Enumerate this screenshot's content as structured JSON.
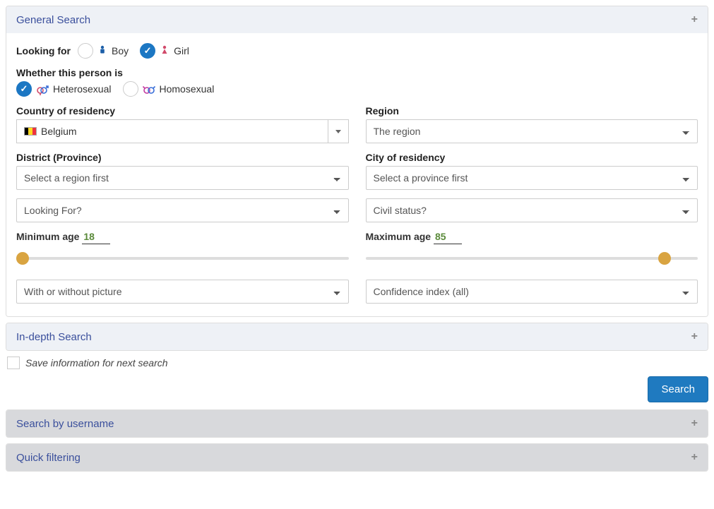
{
  "general": {
    "title": "General Search",
    "looking_for_label": "Looking for",
    "boy_label": "Boy",
    "girl_label": "Girl",
    "orientation_label": "Whether this person is",
    "hetero_label": "Heterosexual",
    "homo_label": "Homosexual",
    "country_label": "Country of residency",
    "country_value": "Belgium",
    "region_label": "Region",
    "region_placeholder": "The region",
    "district_label": "District (Province)",
    "district_placeholder": "Select a region first",
    "city_label": "City of residency",
    "city_placeholder": "Select a province first",
    "looking_for_select": "Looking For?",
    "civil_status_select": "Civil status?",
    "min_age_label": "Minimum age",
    "min_age_value": "18",
    "max_age_label": "Maximum age",
    "max_age_value": "85",
    "picture_select": "With or without picture",
    "confidence_select": "Confidence index (all)"
  },
  "indepth": {
    "title": "In-depth Search"
  },
  "save_label": "Save information for next search",
  "search_button": "Search",
  "by_username": {
    "title": "Search by username"
  },
  "quick_filter": {
    "title": "Quick filtering"
  }
}
